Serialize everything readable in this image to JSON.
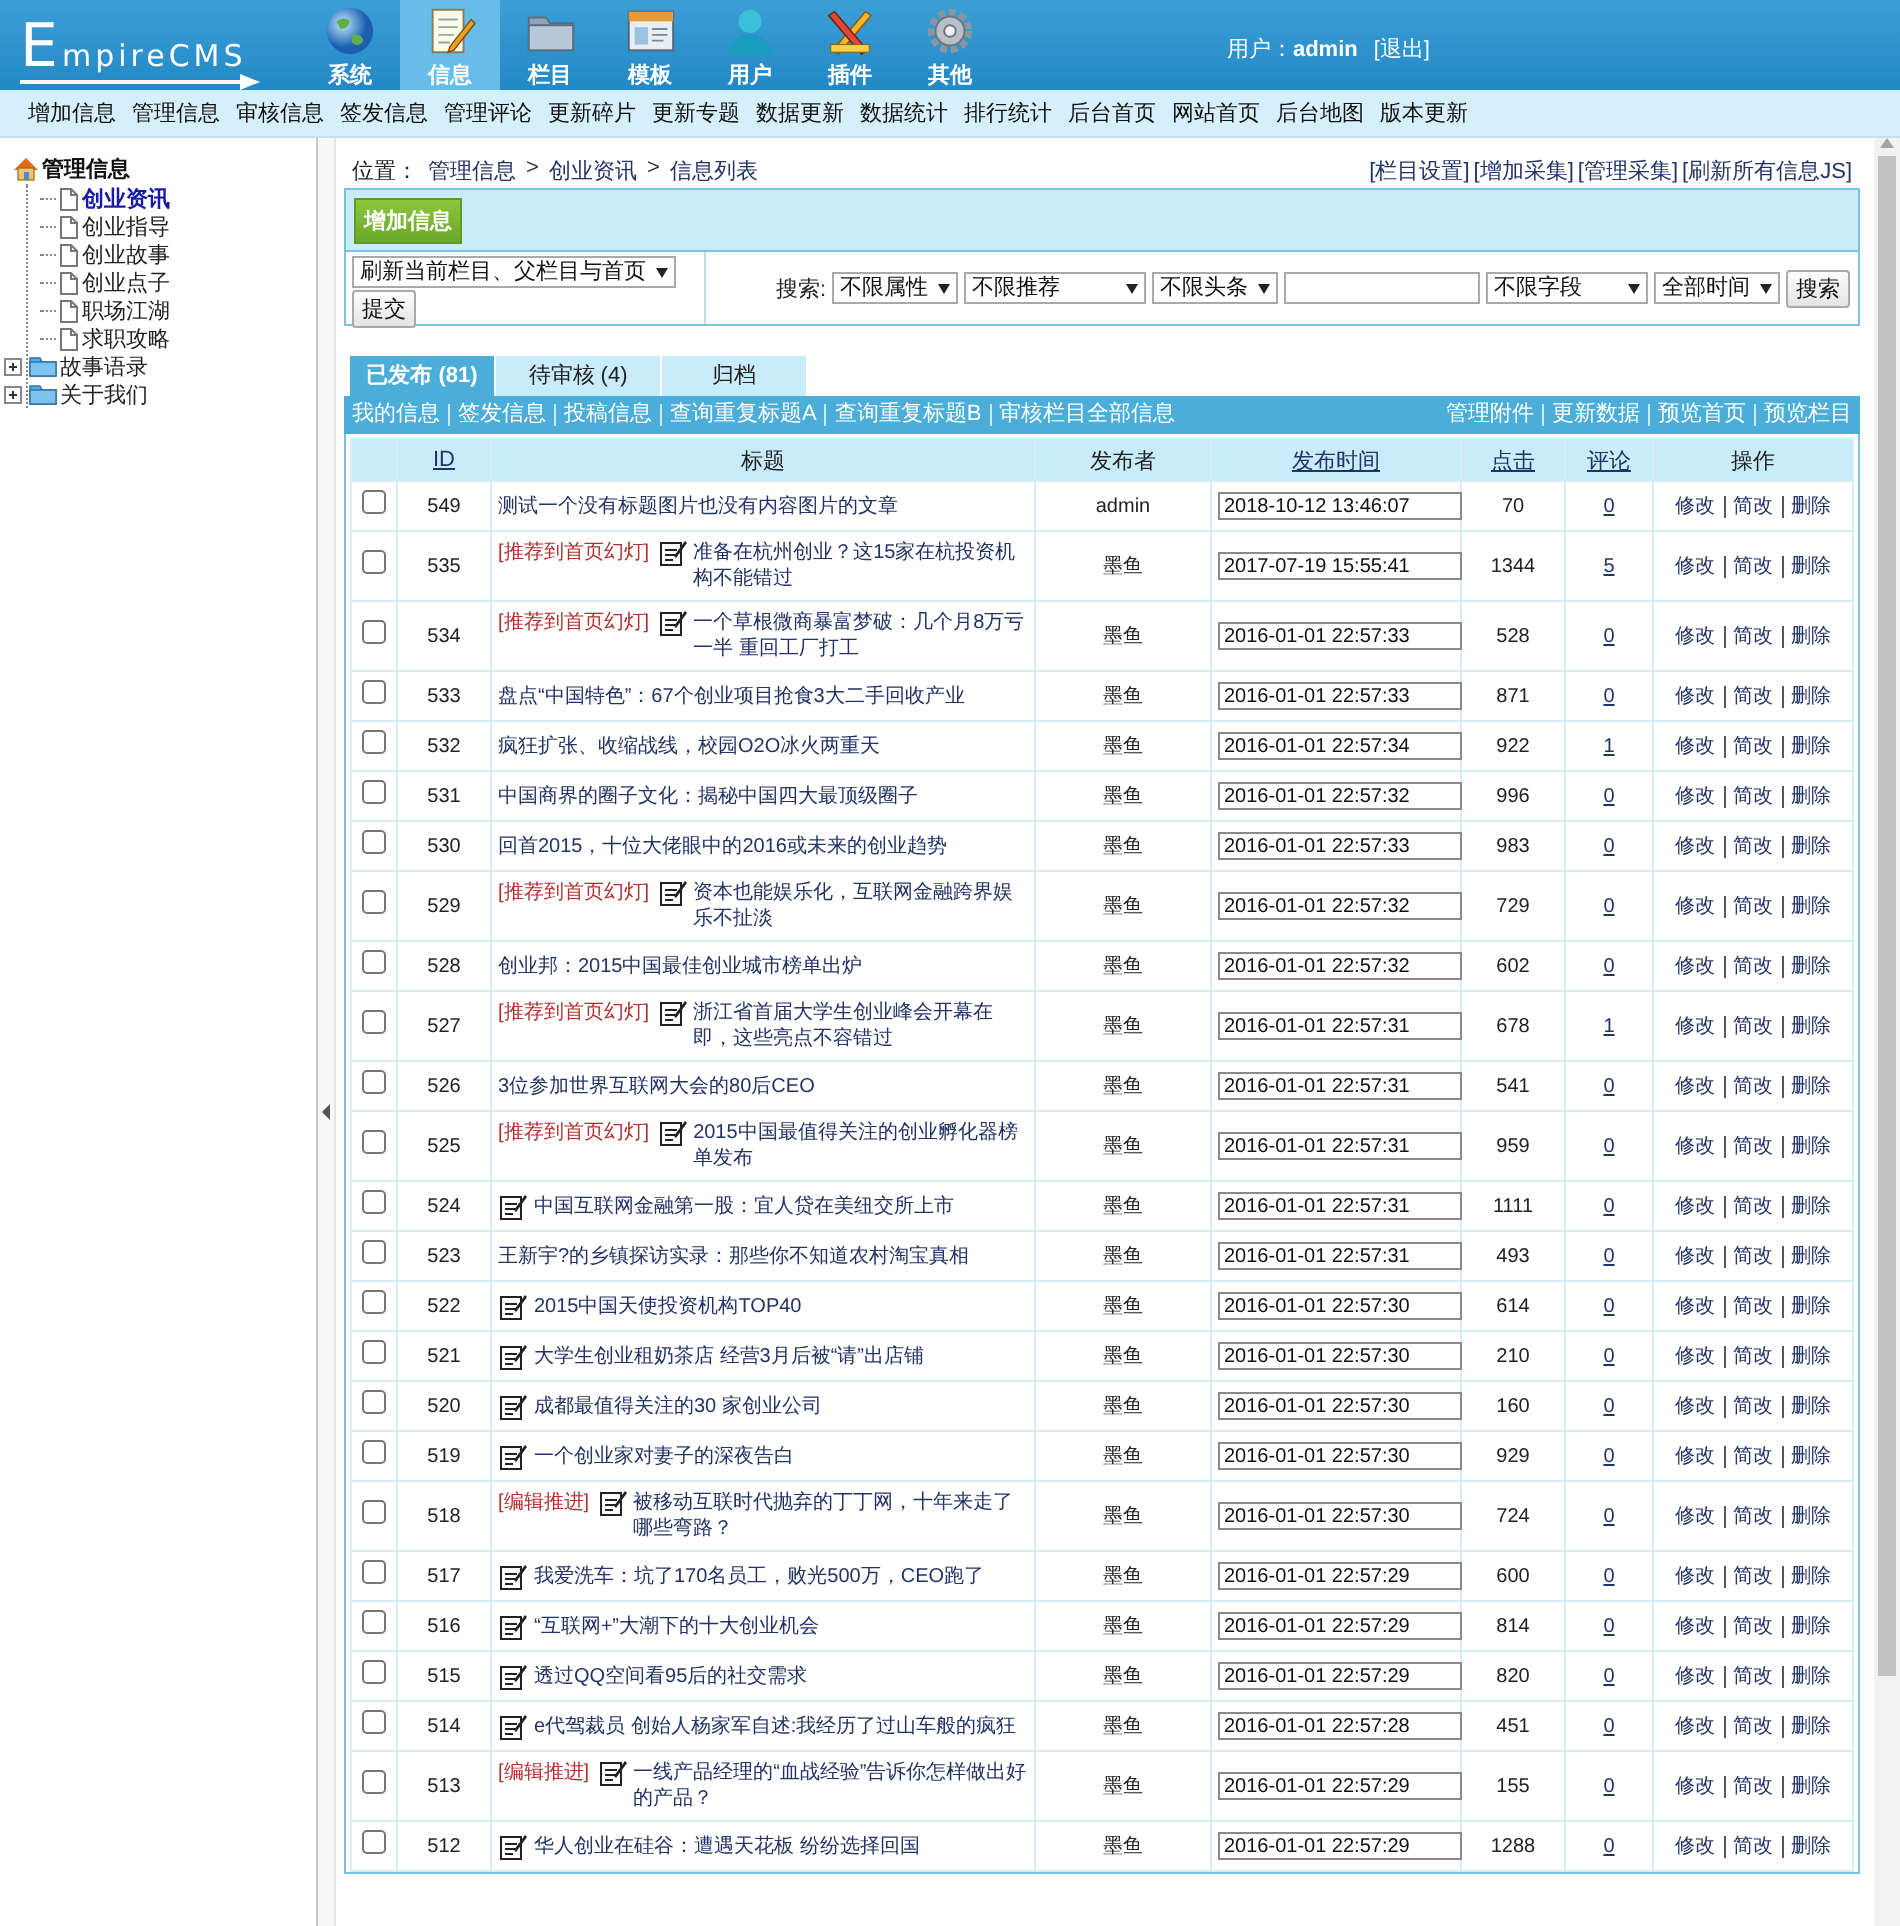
{
  "logo": {
    "text": "EmpireCMS"
  },
  "nav": [
    {
      "label": "系统",
      "kind": "globe",
      "selected": false
    },
    {
      "label": "信息",
      "kind": "notepad",
      "selected": true
    },
    {
      "label": "栏目",
      "kind": "folder",
      "selected": false
    },
    {
      "label": "模板",
      "kind": "window",
      "selected": false
    },
    {
      "label": "用户",
      "kind": "person",
      "selected": false
    },
    {
      "label": "插件",
      "kind": "tools",
      "selected": false
    },
    {
      "label": "其他",
      "kind": "gear",
      "selected": false
    }
  ],
  "user": {
    "label": "用户：",
    "name": "admin",
    "logout": "[退出]"
  },
  "menu": [
    "增加信息",
    "管理信息",
    "审核信息",
    "签发信息",
    "管理评论",
    "更新碎片",
    "更新专题",
    "数据更新",
    "数据统计",
    "排行统计",
    "后台首页",
    "网站首页",
    "后台地图",
    "版本更新"
  ],
  "tree": {
    "label": "管理信息",
    "children": [
      {
        "label": "创业资讯",
        "kind": "page",
        "selected": true
      },
      {
        "label": "创业指导",
        "kind": "page",
        "selected": false
      },
      {
        "label": "创业故事",
        "kind": "page",
        "selected": false
      },
      {
        "label": "创业点子",
        "kind": "page",
        "selected": false
      },
      {
        "label": "职场江湖",
        "kind": "page",
        "selected": false
      },
      {
        "label": "求职攻略",
        "kind": "page",
        "selected": false
      },
      {
        "label": "故事语录",
        "kind": "folder",
        "selected": false,
        "expanded": false
      },
      {
        "label": "关于我们",
        "kind": "folder",
        "selected": false,
        "expanded": false
      }
    ]
  },
  "breadcrumb": {
    "label": "位置：",
    "separator": ">",
    "path": [
      "管理信息",
      "创业资讯",
      "信息列表"
    ]
  },
  "top_links": [
    "[栏目设置]",
    "[增加采集]",
    "[管理采集]",
    "[刷新所有信息JS]"
  ],
  "add_button": "增加信息",
  "refresh": {
    "value": "刷新当前栏目、父栏目与首页",
    "button": "提交"
  },
  "search": {
    "label": "搜索:",
    "filters_a": [
      "不限属性",
      "不限推荐",
      "不限头条"
    ],
    "filters_b": [
      "不限字段",
      "全部时间"
    ],
    "button": "搜索"
  },
  "tabs": [
    {
      "label": "已发布 (81)",
      "selected": true
    },
    {
      "label": "待审核 (4)",
      "selected": false
    },
    {
      "label": "归档",
      "selected": false
    }
  ],
  "links_left": [
    "我的信息",
    "签发信息",
    "投稿信息",
    "查询重复标题A",
    "查询重复标题B",
    "审核栏目全部信息"
  ],
  "links_right": [
    "管理附件",
    "更新数据",
    "预览首页",
    "预览栏目"
  ],
  "table": {
    "columns": [
      {
        "label": "ID",
        "sortable": true
      },
      {
        "label": "标题",
        "sortable": false
      },
      {
        "label": "发布者",
        "sortable": false
      },
      {
        "label": "发布时间",
        "sortable": true
      },
      {
        "label": "点击",
        "sortable": true
      },
      {
        "label": "评论",
        "sortable": true
      },
      {
        "label": "操作",
        "sortable": false
      }
    ],
    "rows": [
      {
        "id": "549",
        "checked": false,
        "title_image": false,
        "title": "测试一个没有标题图片也没有内容图片的文章",
        "author": "admin",
        "time": "2018-10-12 13:46:07",
        "clicks": "70",
        "comments": "0",
        "actions": [
          "修改",
          "简改",
          "删除"
        ]
      },
      {
        "id": "535",
        "checked": false,
        "tag": "[推荐到首页幻灯]",
        "title_image": true,
        "title": "准备在杭州创业？这15家在杭投资机构不能错过",
        "author": "墨鱼",
        "time": "2017-07-19 15:55:41",
        "clicks": "1344",
        "comments": "5",
        "actions": [
          "修改",
          "简改",
          "删除"
        ]
      },
      {
        "id": "534",
        "checked": false,
        "tag": "[推荐到首页幻灯]",
        "title_image": true,
        "title": "一个草根微商暴富梦破：几个月8万亏一半 重回工厂打工",
        "author": "墨鱼",
        "time": "2016-01-01 22:57:33",
        "clicks": "528",
        "comments": "0",
        "actions": [
          "修改",
          "简改",
          "删除"
        ]
      },
      {
        "id": "533",
        "checked": false,
        "title_image": false,
        "title": "盘点“中国特色”：67个创业项目抢食3大二手回收产业",
        "author": "墨鱼",
        "time": "2016-01-01 22:57:33",
        "clicks": "871",
        "comments": "0",
        "actions": [
          "修改",
          "简改",
          "删除"
        ]
      },
      {
        "id": "532",
        "checked": false,
        "title_image": false,
        "title": "疯狂扩张、收缩战线，校园O2O冰火两重天",
        "author": "墨鱼",
        "time": "2016-01-01 22:57:34",
        "clicks": "922",
        "comments": "1",
        "actions": [
          "修改",
          "简改",
          "删除"
        ]
      },
      {
        "id": "531",
        "checked": false,
        "title_image": false,
        "title": "中国商界的圈子文化：揭秘中国四大最顶级圈子",
        "author": "墨鱼",
        "time": "2016-01-01 22:57:32",
        "clicks": "996",
        "comments": "0",
        "actions": [
          "修改",
          "简改",
          "删除"
        ]
      },
      {
        "id": "530",
        "checked": false,
        "title_image": false,
        "title": "回首2015，十位大佬眼中的2016或未来的创业趋势",
        "author": "墨鱼",
        "time": "2016-01-01 22:57:33",
        "clicks": "983",
        "comments": "0",
        "actions": [
          "修改",
          "简改",
          "删除"
        ]
      },
      {
        "id": "529",
        "checked": false,
        "tag": "[推荐到首页幻灯]",
        "title_image": true,
        "title": "资本也能娱乐化，互联网金融跨界娱乐不扯淡",
        "author": "墨鱼",
        "time": "2016-01-01 22:57:32",
        "clicks": "729",
        "comments": "0",
        "actions": [
          "修改",
          "简改",
          "删除"
        ]
      },
      {
        "id": "528",
        "checked": false,
        "title_image": false,
        "title": "创业邦：2015中国最佳创业城市榜单出炉",
        "author": "墨鱼",
        "time": "2016-01-01 22:57:32",
        "clicks": "602",
        "comments": "0",
        "actions": [
          "修改",
          "简改",
          "删除"
        ]
      },
      {
        "id": "527",
        "checked": false,
        "tag": "[推荐到首页幻灯]",
        "title_image": true,
        "title": "浙江省首届大学生创业峰会开幕在即，这些亮点不容错过",
        "author": "墨鱼",
        "time": "2016-01-01 22:57:31",
        "clicks": "678",
        "comments": "1",
        "actions": [
          "修改",
          "简改",
          "删除"
        ]
      },
      {
        "id": "526",
        "checked": false,
        "title_image": false,
        "title": "3位参加世界互联网大会的80后CEO",
        "author": "墨鱼",
        "time": "2016-01-01 22:57:31",
        "clicks": "541",
        "comments": "0",
        "actions": [
          "修改",
          "简改",
          "删除"
        ]
      },
      {
        "id": "525",
        "checked": false,
        "tag": "[推荐到首页幻灯]",
        "title_image": true,
        "title": "2015中国最值得关注的创业孵化器榜单发布",
        "author": "墨鱼",
        "time": "2016-01-01 22:57:31",
        "clicks": "959",
        "comments": "0",
        "actions": [
          "修改",
          "简改",
          "删除"
        ]
      },
      {
        "id": "524",
        "checked": false,
        "title_image": true,
        "title": "中国互联网金融第一股：宜人贷在美纽交所上市",
        "author": "墨鱼",
        "time": "2016-01-01 22:57:31",
        "clicks": "1111",
        "comments": "0",
        "actions": [
          "修改",
          "简改",
          "删除"
        ]
      },
      {
        "id": "523",
        "checked": false,
        "title_image": false,
        "title": "王新宇?的乡镇探访实录：那些你不知道农村淘宝真相",
        "author": "墨鱼",
        "time": "2016-01-01 22:57:31",
        "clicks": "493",
        "comments": "0",
        "actions": [
          "修改",
          "简改",
          "删除"
        ]
      },
      {
        "id": "522",
        "checked": false,
        "title_image": true,
        "title": "2015中国天使投资机构TOP40",
        "author": "墨鱼",
        "time": "2016-01-01 22:57:30",
        "clicks": "614",
        "comments": "0",
        "actions": [
          "修改",
          "简改",
          "删除"
        ]
      },
      {
        "id": "521",
        "checked": false,
        "title_image": true,
        "title": "大学生创业租奶茶店 经营3月后被“请”出店铺",
        "author": "墨鱼",
        "time": "2016-01-01 22:57:30",
        "clicks": "210",
        "comments": "0",
        "actions": [
          "修改",
          "简改",
          "删除"
        ]
      },
      {
        "id": "520",
        "checked": false,
        "title_image": true,
        "title": "成都最值得关注的30 家创业公司",
        "author": "墨鱼",
        "time": "2016-01-01 22:57:30",
        "clicks": "160",
        "comments": "0",
        "actions": [
          "修改",
          "简改",
          "删除"
        ]
      },
      {
        "id": "519",
        "checked": false,
        "title_image": true,
        "title": "一个创业家对妻子的深夜告白",
        "author": "墨鱼",
        "time": "2016-01-01 22:57:30",
        "clicks": "929",
        "comments": "0",
        "actions": [
          "修改",
          "简改",
          "删除"
        ]
      },
      {
        "id": "518",
        "checked": false,
        "tag": "[编辑推进]",
        "title_image": true,
        "title": "被移动互联时代抛弃的丁丁网，十年来走了哪些弯路？",
        "author": "墨鱼",
        "time": "2016-01-01 22:57:30",
        "clicks": "724",
        "comments": "0",
        "actions": [
          "修改",
          "简改",
          "删除"
        ]
      },
      {
        "id": "517",
        "checked": false,
        "title_image": true,
        "title": "我爱洗车：坑了170名员工，败光500万，CEO跑了",
        "author": "墨鱼",
        "time": "2016-01-01 22:57:29",
        "clicks": "600",
        "comments": "0",
        "actions": [
          "修改",
          "简改",
          "删除"
        ]
      },
      {
        "id": "516",
        "checked": false,
        "title_image": true,
        "title": "“互联网+”大潮下的十大创业机会",
        "author": "墨鱼",
        "time": "2016-01-01 22:57:29",
        "clicks": "814",
        "comments": "0",
        "actions": [
          "修改",
          "简改",
          "删除"
        ]
      },
      {
        "id": "515",
        "checked": false,
        "title_image": true,
        "title": "透过QQ空间看95后的社交需求",
        "author": "墨鱼",
        "time": "2016-01-01 22:57:29",
        "clicks": "820",
        "comments": "0",
        "actions": [
          "修改",
          "简改",
          "删除"
        ]
      },
      {
        "id": "514",
        "checked": false,
        "title_image": true,
        "title": "e代驾裁员 创始人杨家军自述:我经历了过山车般的疯狂",
        "author": "墨鱼",
        "time": "2016-01-01 22:57:28",
        "clicks": "451",
        "comments": "0",
        "actions": [
          "修改",
          "简改",
          "删除"
        ]
      },
      {
        "id": "513",
        "checked": false,
        "tag": "[编辑推进]",
        "title_image": true,
        "title": "一线产品经理的“血战经验”告诉你怎样做出好的产品？",
        "author": "墨鱼",
        "time": "2016-01-01 22:57:29",
        "clicks": "155",
        "comments": "0",
        "actions": [
          "修改",
          "简改",
          "删除"
        ]
      },
      {
        "id": "512",
        "checked": false,
        "title_image": true,
        "title": "华人创业在硅谷：遭遇天花板 纷纷选择回国",
        "author": "墨鱼",
        "time": "2016-01-01 22:57:29",
        "clicks": "1288",
        "comments": "0",
        "actions": [
          "修改",
          "简改",
          "删除"
        ]
      }
    ]
  }
}
